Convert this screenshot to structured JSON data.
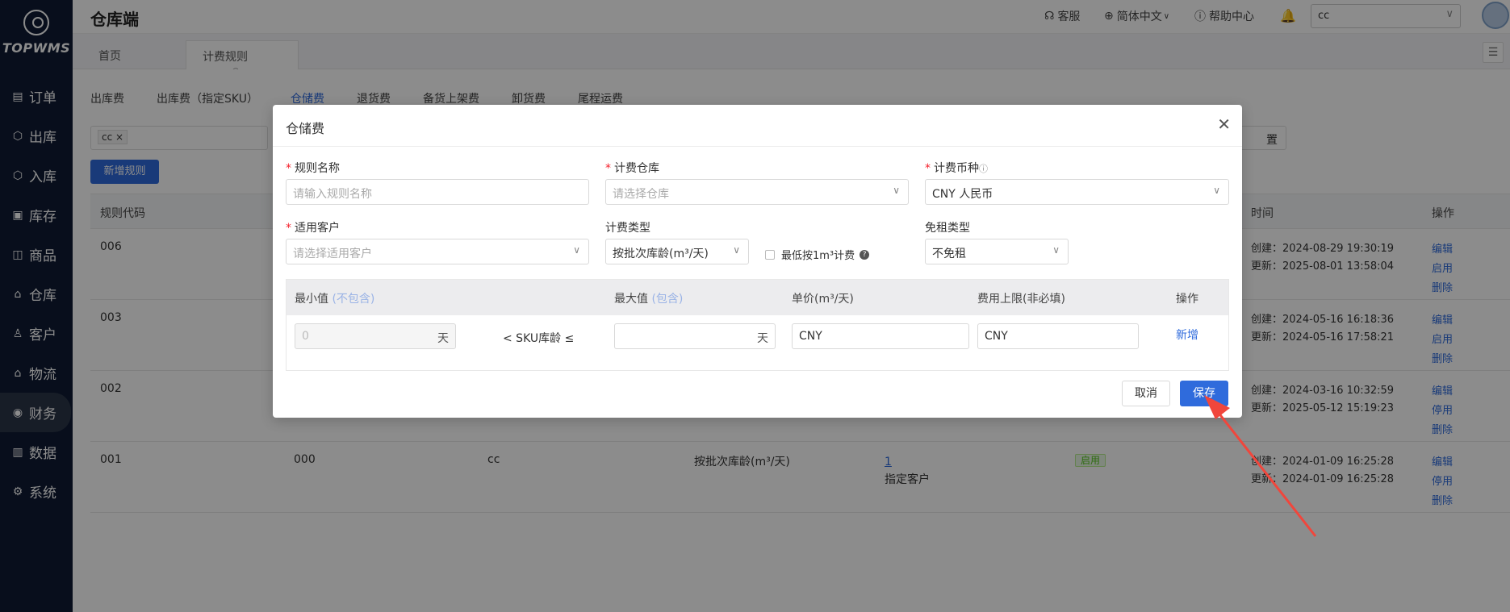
{
  "app": {
    "logo_text": "TOPWMS",
    "title": "仓库端"
  },
  "sidebar": {
    "items": [
      {
        "label": "订单",
        "icon": "order-icon"
      },
      {
        "label": "出库",
        "icon": "outbound-icon"
      },
      {
        "label": "入库",
        "icon": "inbound-icon"
      },
      {
        "label": "库存",
        "icon": "inventory-icon"
      },
      {
        "label": "商品",
        "icon": "product-icon"
      },
      {
        "label": "仓库",
        "icon": "warehouse-icon"
      },
      {
        "label": "客户",
        "icon": "customer-icon"
      },
      {
        "label": "物流",
        "icon": "logistics-icon"
      },
      {
        "label": "财务",
        "icon": "finance-icon",
        "active": true
      },
      {
        "label": "数据",
        "icon": "data-icon"
      },
      {
        "label": "系统",
        "icon": "settings-icon"
      }
    ]
  },
  "header": {
    "customer_service": "客服",
    "language": "简体中文",
    "help": "帮助中心",
    "warehouse_select": "cc"
  },
  "tabs": [
    {
      "label": "首页"
    },
    {
      "label": "计费规则",
      "active": true
    }
  ],
  "subtabs": [
    {
      "label": "出库费"
    },
    {
      "label": "出库费（指定SKU）"
    },
    {
      "label": "仓储费",
      "active": true
    },
    {
      "label": "退货费"
    },
    {
      "label": "备货上架费"
    },
    {
      "label": "卸货费"
    },
    {
      "label": "尾程运费"
    }
  ],
  "filter": {
    "tag": "cc",
    "reset_label": "置"
  },
  "add_rule_button": "新增规则",
  "table": {
    "headers": {
      "code": "规则代码",
      "time": "时间",
      "ops": "操作"
    },
    "rows": [
      {
        "code": "006",
        "created": "创建：2024-08-29 19:30:19",
        "updated": "更新：2025-08-01 13:58:04",
        "ops": [
          "编辑",
          "启用",
          "删除"
        ]
      },
      {
        "code": "003",
        "created": "创建：2024-05-16 16:18:36",
        "updated": "更新：2024-05-16 17:58:21",
        "ops": [
          "编辑",
          "启用",
          "删除"
        ]
      },
      {
        "code": "002",
        "created": "创建：2024-03-16 10:32:59",
        "updated": "更新：2025-05-12 15:19:23",
        "ops": [
          "编辑",
          "停用",
          "删除"
        ]
      },
      {
        "code": "001",
        "name": "000",
        "warehouse": "cc",
        "type": "按批次库龄(m³/天)",
        "customer_count": "1",
        "customer_label": "指定客户",
        "status": "启用",
        "created": "创建：2024-01-09 16:25:28",
        "updated": "更新：2024-01-09 16:25:28",
        "ops": [
          "编辑",
          "停用",
          "删除"
        ]
      }
    ]
  },
  "modal": {
    "title": "仓储费",
    "fields": {
      "rule_name_label": "规则名称",
      "rule_name_placeholder": "请输入规则名称",
      "warehouse_label": "计费仓库",
      "warehouse_placeholder": "请选择仓库",
      "currency_label": "计费币种",
      "currency_value": "CNY 人民币",
      "customer_label": "适用客户",
      "customer_placeholder": "请选择适用客户",
      "billing_type_label": "计费类型",
      "billing_type_value": "按批次库龄(m³/天)",
      "min_1m3_label": "最低按1m³计费",
      "free_type_label": "免租类型",
      "free_type_value": "不免租"
    },
    "range_table": {
      "min_label": "最小值",
      "min_hint": "(不包含)",
      "max_label": "最大值",
      "max_hint": "(包含)",
      "price_label": "单价(m³/天)",
      "cap_label": "费用上限(非必填)",
      "ops_label": "操作",
      "min_value": "0",
      "unit_day": "天",
      "sku_condition": "<  SKU库龄  ≤",
      "price_value": "CNY",
      "cap_value": "CNY",
      "add_label": "新增"
    },
    "cancel_label": "取消",
    "save_label": "保存"
  },
  "colors": {
    "primary": "#2f6bdc",
    "sidebar": "#0f1b33",
    "arrow": "#f0463c"
  }
}
